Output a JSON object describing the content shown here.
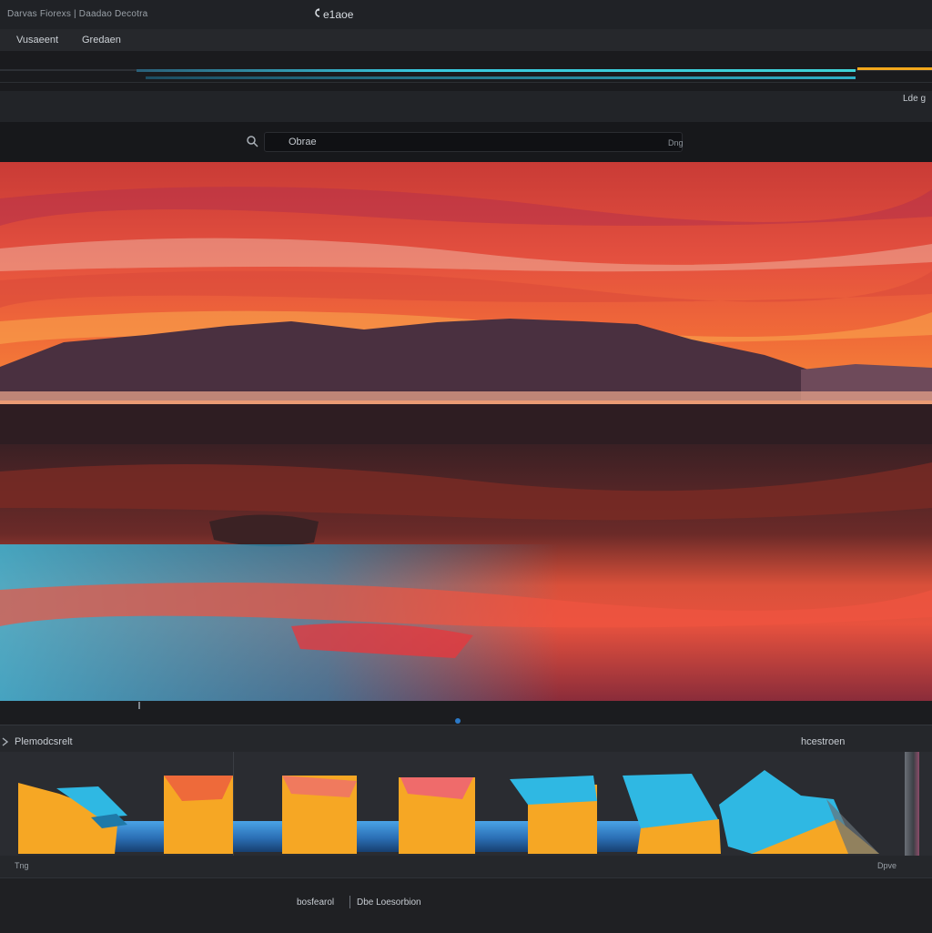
{
  "window": {
    "title_left": "Darvas Fiorexs | Daadao Decotra",
    "title_center": "e1aoe"
  },
  "menu": {
    "items": [
      "Vusaeent",
      "Gredaen"
    ]
  },
  "toolbar": {
    "right_label": "Lde g"
  },
  "search": {
    "value": "Obrae",
    "right_hint": "Dng"
  },
  "panel": {
    "title": "Plemodcsrelt",
    "right_label": "hcestroen",
    "left_bottom": "Tng",
    "right_bottom": "Dpve"
  },
  "footer": {
    "left": "bosfearol",
    "right": "Dbe Loesorbion"
  },
  "colors": {
    "accent_cyan": "#38c9df",
    "accent_orange": "#f2a81c",
    "accent_blue": "#2b79c7",
    "block_orange": "#f6a724",
    "block_cyan": "#2fb8e3"
  },
  "icons": [
    "app-logo-icon",
    "search-icon",
    "panel-toggle-icon",
    "playhead-marker-icon"
  ]
}
